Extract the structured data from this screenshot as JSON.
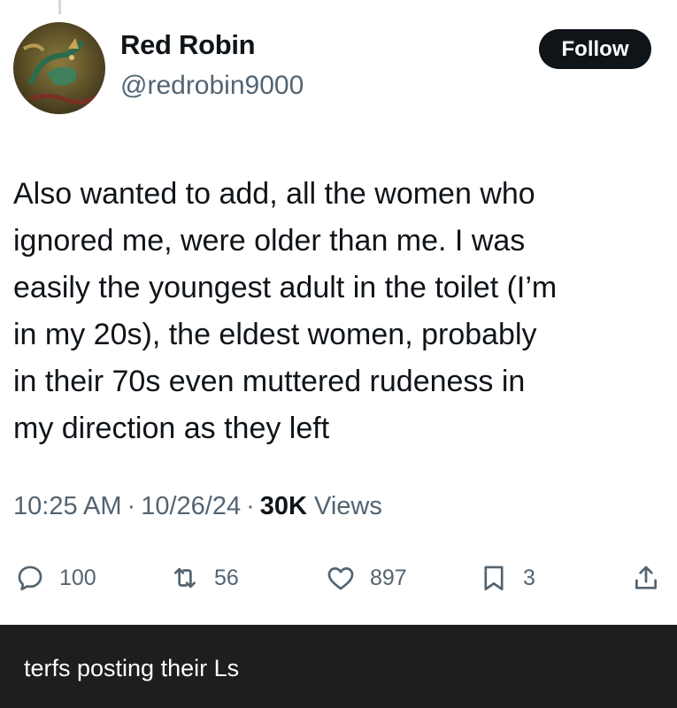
{
  "tweet": {
    "author_name": "Red Robin",
    "author_handle": "@redrobin9000",
    "follow_label": "Follow",
    "text": "Also wanted to add, all the women who\nignored me, were older than me. I was\neasily the youngest adult in the toilet (I’m\nin my 20s), the eldest women, probably\nin their 70s even muttered rudeness in\nmy direction as they left",
    "time": "10:25 AM",
    "separator": "·",
    "date": "10/26/24",
    "views_count": "30K",
    "views_label": "Views",
    "actions": {
      "replies": "100",
      "reposts": "56",
      "likes": "897",
      "bookmarks": "3"
    }
  },
  "caption": "terfs posting their Ls",
  "icons": [
    "reply-icon",
    "repost-icon",
    "like-icon",
    "bookmark-icon",
    "share-icon"
  ],
  "colors": {
    "text_primary": "#0f1419",
    "text_secondary": "#536471",
    "follow_bg": "#0f1419",
    "caption_bar": "#1e1e1e"
  }
}
